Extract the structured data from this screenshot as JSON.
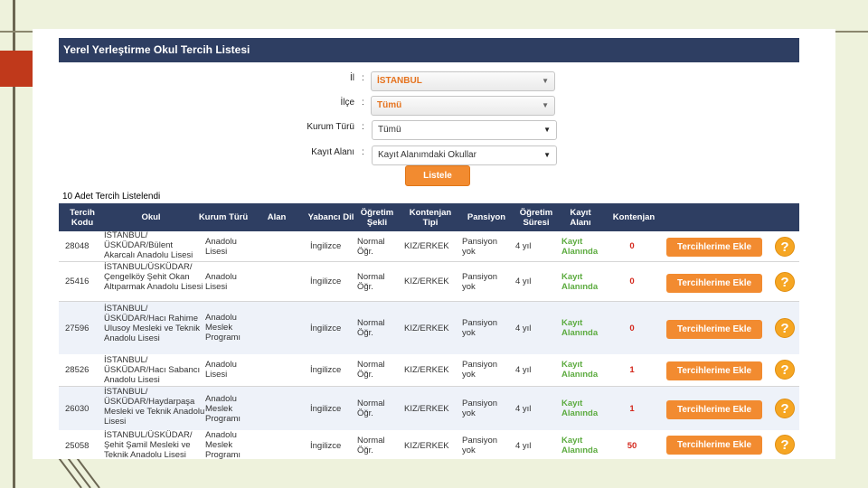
{
  "window": {
    "title": "Yerel Yerleştirme Okul Tercih Listesi"
  },
  "filters": {
    "il": {
      "label": "İl",
      "value": "İSTANBUL"
    },
    "ilce": {
      "label": "İlçe",
      "value": "Tümü"
    },
    "kurum_turu": {
      "label": "Kurum Türü",
      "value": "Tümü"
    },
    "kayit_alani": {
      "label": "Kayıt Alanı",
      "value": "Kayıt Alanımdaki Okullar"
    },
    "colon": ":",
    "submit_label": "Listele"
  },
  "result_count": "10 Adet Tercih Listelendi",
  "table": {
    "headers": [
      "Tercih Kodu",
      "Okul",
      "Kurum Türü",
      "Alan",
      "Yabancı Dil",
      "Öğretim Şekli",
      "Kontenjan Tipi",
      "Pansiyon",
      "Öğretim Süresi",
      "Kayıt Alanı",
      "Kontenjan"
    ],
    "rows": [
      {
        "kod": "28048",
        "okul": "İSTANBUL/ ÜSKÜDAR/Bülent Akarcalı Anadolu Lisesi",
        "kurum": "Anadolu Lisesi",
        "alan": "",
        "dil": "İngilizce",
        "sekil": "Normal Öğr.",
        "tip": "KIZ/ERKEK",
        "pansiyon": "Pansiyon yok",
        "sure": "4 yıl",
        "kayit": "Kayıt Alanında",
        "kontenjan": "0",
        "button": "Tercihlerime Ekle",
        "help": "?"
      },
      {
        "kod": "25416",
        "okul": "İSTANBUL/ÜSKÜDAR/ Çengelköy Şehit Okan Altıparmak Anadolu Lisesi",
        "kurum": "Anadolu Lisesi",
        "alan": "",
        "dil": "İngilizce",
        "sekil": "Normal Öğr.",
        "tip": "KIZ/ERKEK",
        "pansiyon": "Pansiyon yok",
        "sure": "4 yıl",
        "kayit": "Kayıt Alanında",
        "kontenjan": "0",
        "button": "Tercihlerime Ekle",
        "help": "?"
      },
      {
        "kod": "27596",
        "okul": "İSTANBUL/ ÜSKÜDAR/Hacı Rahime Ulusoy Mesleki ve Teknik Anadolu Lisesi",
        "kurum": "Anadolu Meslek Programı",
        "alan": "",
        "dil": "İngilizce",
        "sekil": "Normal Öğr.",
        "tip": "KIZ/ERKEK",
        "pansiyon": "Pansiyon yok",
        "sure": "4 yıl",
        "kayit": "Kayıt Alanında",
        "kontenjan": "0",
        "button": "Tercihlerime Ekle",
        "help": "?"
      },
      {
        "kod": "28526",
        "okul": "İSTANBUL/ ÜSKÜDAR/Hacı Sabancı Anadolu Lisesi",
        "kurum": "Anadolu Lisesi",
        "alan": "",
        "dil": "İngilizce",
        "sekil": "Normal Öğr.",
        "tip": "KIZ/ERKEK",
        "pansiyon": "Pansiyon yok",
        "sure": "4 yıl",
        "kayit": "Kayıt Alanında",
        "kontenjan": "1",
        "button": "Tercihlerime Ekle",
        "help": "?"
      },
      {
        "kod": "26030",
        "okul": "İSTANBUL/ ÜSKÜDAR/Haydarpaşa Mesleki ve Teknik Anadolu Lisesi",
        "kurum": "Anadolu Meslek Programı",
        "alan": "",
        "dil": "İngilizce",
        "sekil": "Normal Öğr.",
        "tip": "KIZ/ERKEK",
        "pansiyon": "Pansiyon yok",
        "sure": "4 yıl",
        "kayit": "Kayıt Alanında",
        "kontenjan": "1",
        "button": "Tercihlerime Ekle",
        "help": "?"
      },
      {
        "kod": "25058",
        "okul": "İSTANBUL/ÜSKÜDAR/ Şehit Şamil Mesleki ve Teknik Anadolu Lisesi",
        "kurum": "Anadolu Meslek Programı",
        "alan": "",
        "dil": "İngilizce",
        "sekil": "Normal Öğr.",
        "tip": "KIZ/ERKEK",
        "pansiyon": "Pansiyon yok",
        "sure": "4 yıl",
        "kayit": "Kayıt Alanında",
        "kontenjan": "50",
        "button": "Tercihlerime Ekle",
        "help": "?"
      }
    ]
  },
  "colors": {
    "header_bg": "#2e3e62",
    "accent_orange": "#f28b30",
    "status_green": "#5cab3f",
    "quota_red": "#d4281d",
    "slide_bg": "#eef2dc",
    "slide_red_marker": "#c0391b"
  },
  "icons": {
    "help": "question-circle-icon",
    "dropdown": "caret-down-icon"
  }
}
